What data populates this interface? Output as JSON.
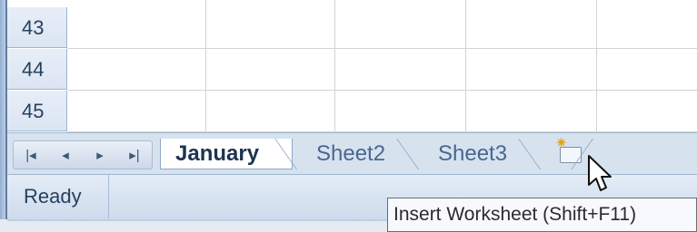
{
  "grid": {
    "rows": [
      {
        "number": "43"
      },
      {
        "number": "44"
      },
      {
        "number": "45"
      }
    ]
  },
  "sheet_nav": {
    "buttons": [
      {
        "icon": "first-sheet-icon",
        "glyph": "|◂"
      },
      {
        "icon": "prev-sheet-icon",
        "glyph": "◂"
      },
      {
        "icon": "next-sheet-icon",
        "glyph": "▸"
      },
      {
        "icon": "last-sheet-icon",
        "glyph": "▸|"
      }
    ]
  },
  "tabs": [
    {
      "label": "January",
      "active": true
    },
    {
      "label": "Sheet2",
      "active": false
    },
    {
      "label": "Sheet3",
      "active": false
    }
  ],
  "insert_worksheet": {
    "icon": "insert-worksheet-icon"
  },
  "status": {
    "text": "Ready"
  },
  "tooltip": {
    "text": "Insert Worksheet (Shift+F11)"
  },
  "colors": {
    "header_bg": "#dbe5f1",
    "tab_bar_bg": "#d7e2ef",
    "status_bg": "#cddbec",
    "accent_text": "#27415f"
  }
}
